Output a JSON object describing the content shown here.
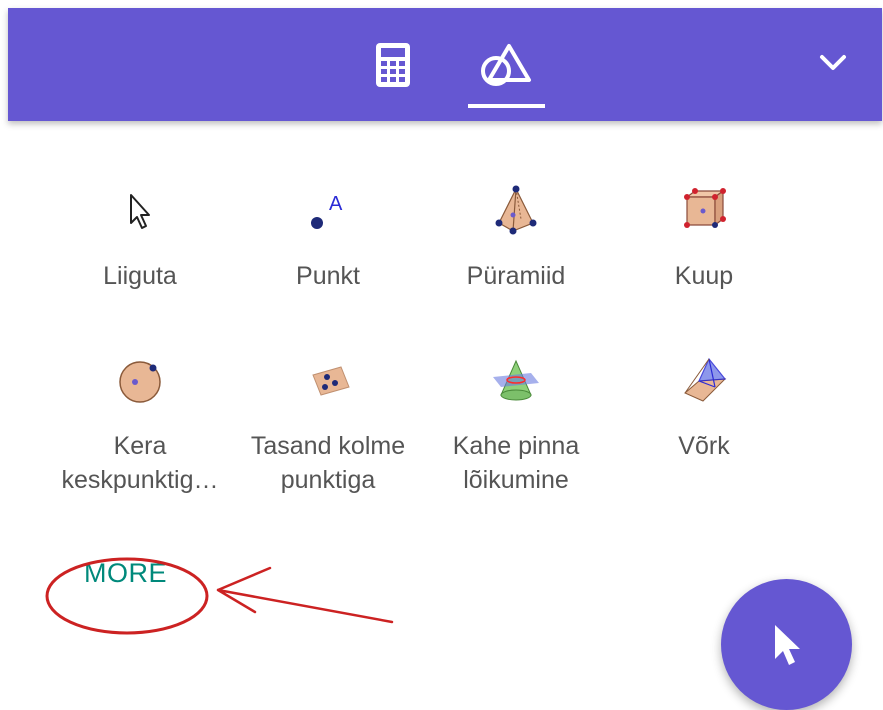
{
  "header": {
    "tabs": [
      {
        "name": "calculator",
        "icon": "calculator-icon"
      },
      {
        "name": "geometry-3d",
        "icon": "shapes-icon",
        "selected": true
      }
    ],
    "collapse_icon": "chevron-down-icon"
  },
  "tools": [
    {
      "label": "Liiguta",
      "icon": "move-cursor-icon"
    },
    {
      "label": "Punkt",
      "icon": "point-icon"
    },
    {
      "label": "Püramiid",
      "icon": "pyramid-icon"
    },
    {
      "label": "Kuup",
      "icon": "cube-icon"
    },
    {
      "label": "Kera\nkeskpunktig…",
      "icon": "sphere-icon"
    },
    {
      "label": "Tasand kolme\npunktiga",
      "icon": "plane-three-points-icon"
    },
    {
      "label": "Kahe pinna\nlõikumine",
      "icon": "intersect-surfaces-icon"
    },
    {
      "label": "Võrk",
      "icon": "net-icon"
    }
  ],
  "more_label": "MORE",
  "fab_icon": "move-cursor-icon",
  "colors": {
    "accent": "#6557d2",
    "more": "#00897b",
    "annotation": "#cc2222"
  }
}
